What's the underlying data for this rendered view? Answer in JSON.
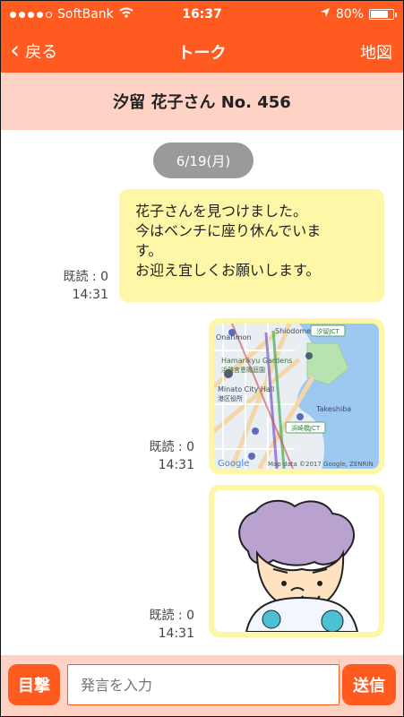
{
  "status_bar": {
    "carrier": "SoftBank",
    "time": "16:37",
    "battery_percent": "80%",
    "battery_level": 0.8,
    "icons": [
      "signal-dots",
      "wifi-icon",
      "location-arrow-icon",
      "battery-icon"
    ]
  },
  "nav": {
    "back_label": "戻る",
    "title": "トーク",
    "map_label": "地図"
  },
  "header": {
    "name": "汐留 花子さん  No. 456"
  },
  "chat": {
    "date_chip": "6/19(月)",
    "messages": [
      {
        "type": "text",
        "lines": [
          "花子さんを見つけました。",
          "今はベンチに座り休んでいま",
          "す。",
          "お迎え宜しくお願いします。"
        ],
        "read_label": "既読 : 0",
        "time": "14:31"
      },
      {
        "type": "image",
        "image_kind": "map",
        "map_labels": {
          "shiodome": "Shiodome",
          "onarimon": "Onarimon",
          "garden": "Hamarikyu Gardens",
          "garden_jp": "浜離宮恩賜庭園",
          "minato": "Minato City Hall",
          "minato_jp": "港区役所",
          "takeshiba": "Takeshiba",
          "hamamatsucho_jct": "浜崎橋JCT",
          "shiodome_jct": "汐留JCT",
          "google": "Google",
          "map_data": "Map data ©2017 Google, ZENRIN"
        },
        "read_label": "既読 : 0",
        "time": "14:31"
      },
      {
        "type": "image",
        "image_kind": "caricature",
        "read_label": "既読 : 0",
        "time": "14:31"
      }
    ]
  },
  "bottom_bar": {
    "left_button": "目撃",
    "input_placeholder": "発言を入力",
    "send_button": "送信"
  },
  "colors": {
    "accent": "#ff5a1f",
    "header_bg": "#ffd2c6",
    "bubble_bg": "#fff7a8",
    "date_chip_bg": "#9a9a9a"
  }
}
